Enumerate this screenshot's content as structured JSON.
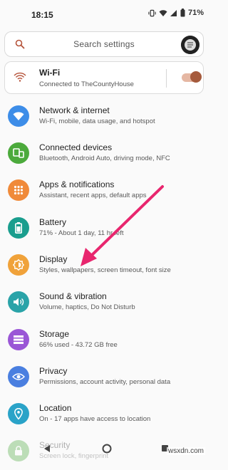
{
  "status_bar": {
    "time": "18:15",
    "battery": "71%"
  },
  "search": {
    "placeholder": "Search settings"
  },
  "wifi": {
    "title": "Wi-Fi",
    "subtitle": "Connected to TheCountyHouse",
    "enabled": true
  },
  "items": [
    {
      "title": "Network & internet",
      "subtitle": "Wi-Fi, mobile, data usage, and hotspot",
      "icon": "wifi-icon",
      "color": "#3d8de8"
    },
    {
      "title": "Connected devices",
      "subtitle": "Bluetooth, Android Auto, driving mode, NFC",
      "icon": "devices-icon",
      "color": "#4caa3c"
    },
    {
      "title": "Apps & notifications",
      "subtitle": "Assistant, recent apps, default apps",
      "icon": "apps-icon",
      "color": "#f08a3a"
    },
    {
      "title": "Battery",
      "subtitle": "71% - About 1 day, 11 hr left",
      "icon": "battery-icon",
      "color": "#1a9e8e"
    },
    {
      "title": "Display",
      "subtitle": "Styles, wallpapers, screen timeout, font size",
      "icon": "brightness-icon",
      "color": "#f0a23a"
    },
    {
      "title": "Sound & vibration",
      "subtitle": "Volume, haptics, Do Not Disturb",
      "icon": "volume-icon",
      "color": "#2aa3a8"
    },
    {
      "title": "Storage",
      "subtitle": "66% used - 43.72 GB free",
      "icon": "storage-icon",
      "color": "#9a56d6"
    },
    {
      "title": "Privacy",
      "subtitle": "Permissions, account activity, personal data",
      "icon": "eye-icon",
      "color": "#4a7fe0"
    },
    {
      "title": "Location",
      "subtitle": "On - 17 apps have access to location",
      "icon": "location-pin-icon",
      "color": "#2aa3c8"
    },
    {
      "title": "Security",
      "subtitle": "Screen lock, fingerprint",
      "icon": "lock-icon",
      "color": "#4caa3c"
    }
  ],
  "watermark": "wsxdn.com",
  "colors": {
    "accent": "#a55a3c",
    "arrow": "#e8266e"
  }
}
